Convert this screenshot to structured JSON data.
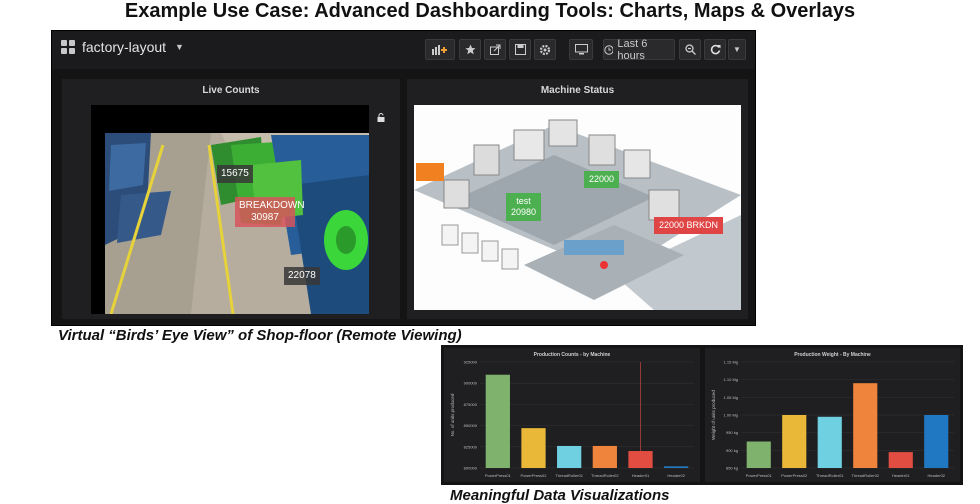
{
  "slide": {
    "title": "Example Use Case: Advanced Dashboarding Tools: Charts, Maps & Overlays",
    "caption_birds_eye": "Virtual “Birds’ Eye View” of Shop-floor (Remote Viewing)",
    "caption_visualizations": "Meaningful Data Visualizations"
  },
  "dashboard": {
    "title": "factory-layout",
    "time_range": "Last 6 hours",
    "toolbar_icons": [
      "add-panel-icon",
      "star-icon",
      "share-icon",
      "save-icon",
      "gear-icon",
      "tv-mode-icon",
      "clock-icon",
      "zoom-out-icon",
      "refresh-icon",
      "chevron-down-icon"
    ]
  },
  "live_counts": {
    "title": "Live Counts",
    "overlays": [
      {
        "line1": "15675",
        "line2": "",
        "status": "normal"
      },
      {
        "line1": "BREAKDOWN",
        "line2": "30987",
        "status": "alert"
      },
      {
        "line1": "22078",
        "line2": "",
        "status": "normal"
      }
    ]
  },
  "machine_status": {
    "title": "Machine Status",
    "labels": [
      {
        "line1": "test",
        "line2": "20980",
        "color": "#4caf50"
      },
      {
        "line1": "22000",
        "line2": "",
        "color": "#4caf50"
      },
      {
        "line1": "22000 BRKDN",
        "line2": "",
        "color": "#e04545"
      },
      {
        "line1": "",
        "line2": "",
        "color": "#f08020"
      }
    ]
  },
  "colors": {
    "bg": "#141414",
    "panel": "#1f1f21",
    "green": "#7eb26d",
    "yellow": "#eab839",
    "cyan": "#6ed0e0",
    "orange": "#ef843c",
    "red": "#e24d42",
    "blue": "#1f78c1"
  },
  "chart_data": [
    {
      "type": "bar",
      "title": "Production Counts - by Machine",
      "ylabel": "No. of units produced",
      "categories": [
        "PowerPress01",
        "PowerPress02",
        "ThreadRoller01",
        "ThreadRoller02",
        "Header01",
        "Header02"
      ],
      "values": [
        910000,
        847000,
        826000,
        826000,
        820000,
        802000
      ],
      "ylim": [
        800000,
        925000
      ],
      "yticks": [
        "800000",
        "825000",
        "850000",
        "875000",
        "900000",
        "925000"
      ],
      "colors": [
        "#7eb26d",
        "#eab839",
        "#6ed0e0",
        "#ef843c",
        "#e24d42",
        "#1f78c1"
      ]
    },
    {
      "type": "bar",
      "title": "Production Weight - By Machine",
      "ylabel": "Weight of units produced",
      "categories": [
        "PowerPress01",
        "PowerPress02",
        "ThreadRoller01",
        "ThreadRoller02",
        "Header01",
        "Header02"
      ],
      "values": [
        925,
        1000,
        995,
        1090,
        895,
        1000
      ],
      "ylim": [
        850,
        1150
      ],
      "yticks": [
        "850 kg",
        "900 kg",
        "950 kg",
        "1.00 Mg",
        "1.05 Mg",
        "1.10 Mg",
        "1.15 Mg"
      ],
      "colors": [
        "#7eb26d",
        "#eab839",
        "#6ed0e0",
        "#ef843c",
        "#e24d42",
        "#1f78c1"
      ]
    }
  ]
}
